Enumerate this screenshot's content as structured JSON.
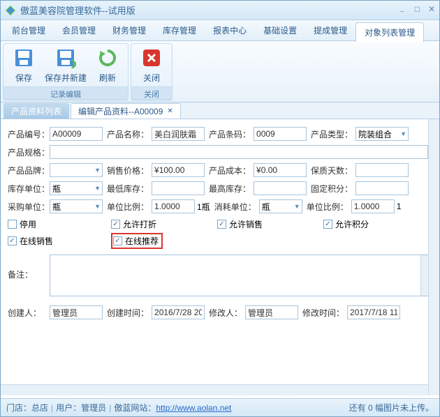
{
  "window": {
    "title": "傲蓝美容院管理软件--试用版"
  },
  "menu": {
    "items": [
      "前台管理",
      "会员管理",
      "财务管理",
      "库存管理",
      "报表中心",
      "基础设置",
      "提成管理",
      "对象列表管理"
    ],
    "active_index": 7
  },
  "ribbon": {
    "group1": {
      "label": "记录编辑",
      "buttons": [
        {
          "label": "保存",
          "icon": "save"
        },
        {
          "label": "保存并新建",
          "icon": "save-new"
        },
        {
          "label": "刷新",
          "icon": "refresh"
        }
      ]
    },
    "group2": {
      "label": "关闭",
      "buttons": [
        {
          "label": "关闭",
          "icon": "close"
        }
      ]
    }
  },
  "tabs": [
    {
      "label": "产品资料列表",
      "active": false,
      "closable": false
    },
    {
      "label": "编辑产品资料--A00009",
      "active": true,
      "closable": true
    }
  ],
  "form": {
    "product_code": {
      "label": "产品编号：",
      "value": "A00009"
    },
    "product_name": {
      "label": "产品名称：",
      "value": "美白润肤霜"
    },
    "product_barcode": {
      "label": "产品条码：",
      "value": "0009"
    },
    "product_type": {
      "label": "产品类型：",
      "value": "院装组合"
    },
    "product_spec": {
      "label": "产品规格：",
      "value": ""
    },
    "product_brand": {
      "label": "产品品牌：",
      "value": ""
    },
    "sale_price": {
      "label": "销售价格：",
      "value": "¥100.00"
    },
    "product_cost": {
      "label": "产品成本：",
      "value": "¥0.00"
    },
    "shelf_days": {
      "label": "保质天数：",
      "value": ""
    },
    "stock_unit": {
      "label": "库存单位：",
      "value": "瓶"
    },
    "min_stock": {
      "label": "最低库存：",
      "value": ""
    },
    "max_stock": {
      "label": "最高库存：",
      "value": ""
    },
    "fixed_points": {
      "label": "固定积分：",
      "value": ""
    },
    "purchase_unit": {
      "label": "采购单位：",
      "value": "瓶"
    },
    "unit_ratio1": {
      "label": "单位比例：",
      "value": "1.0000"
    },
    "ratio_suffix1": "1瓶",
    "consume_unit": {
      "label": "消耗单位：",
      "value": "瓶"
    },
    "unit_ratio2": {
      "label": "单位比例：",
      "value": "1.0000"
    },
    "ratio_suffix2": "1",
    "notes": {
      "label": "备注：",
      "value": ""
    },
    "creator": {
      "label": "创建人：",
      "value": "管理员"
    },
    "create_time": {
      "label": "创建时间：",
      "value": "2016/7/28 20"
    },
    "modifier": {
      "label": "修改人：",
      "value": "管理员"
    },
    "modify_time": {
      "label": "修改时间：",
      "value": "2017/7/18 11"
    }
  },
  "checks": {
    "disabled": {
      "label": "停用",
      "checked": false
    },
    "allow_discount": {
      "label": "允许打折",
      "checked": true
    },
    "allow_sale": {
      "label": "允许销售",
      "checked": true
    },
    "allow_points": {
      "label": "允许积分",
      "checked": true
    },
    "online_sale": {
      "label": "在线销售",
      "checked": true
    },
    "online_recommend": {
      "label": "在线推荐",
      "checked": true
    }
  },
  "statusbar": {
    "store_label": "门店：",
    "store": "总店",
    "user_label": "用户：",
    "user": "管理员",
    "site_label": "傲蓝网站：",
    "site_url": "http://www.aolan.net",
    "right_text": "还有 0 幅图片未上传。"
  }
}
